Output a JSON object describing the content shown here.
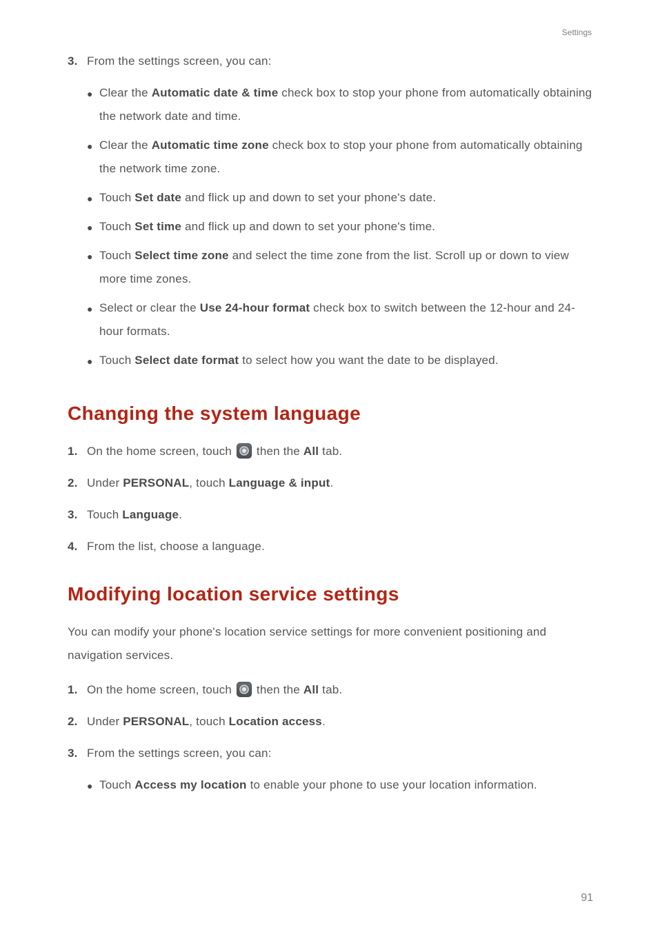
{
  "header": {
    "section_label": "Settings"
  },
  "step3": {
    "num": "3.",
    "lead": "From the settings screen, you can:",
    "bullets": [
      {
        "pre": "Clear the ",
        "bold": "Automatic date & time",
        "post": " check box to stop your phone from automatically obtaining the network date and time."
      },
      {
        "pre": "Clear the ",
        "bold": "Automatic time zone",
        "post": " check box to stop your phone from automatically obtaining the network time zone."
      },
      {
        "pre": "Touch ",
        "bold": "Set date",
        "post": " and flick up and down to set your phone's date."
      },
      {
        "pre": "Touch ",
        "bold": "Set time",
        "post": " and flick up and down to set your phone's time."
      },
      {
        "pre": "Touch ",
        "bold": "Select time zone",
        "post": " and select the time zone from the list. Scroll up or down to view more time zones."
      },
      {
        "pre": "Select or clear the ",
        "bold": "Use 24-hour format",
        "post": " check box to switch between the 12-hour and 24-hour formats."
      },
      {
        "pre": "Touch ",
        "bold": "Select date format",
        "post": " to select how you want the date to be displayed."
      }
    ]
  },
  "section_lang": {
    "heading": "Changing the system language",
    "steps": {
      "s1": {
        "num": "1.",
        "pre": "On the home screen, touch ",
        "mid": " then the ",
        "bold": "All",
        "post": " tab."
      },
      "s2": {
        "num": "2.",
        "pre": "Under ",
        "bold1": "PERSONAL",
        "mid": ", touch ",
        "bold2": "Language & input",
        "post": "."
      },
      "s3": {
        "num": "3.",
        "pre": "Touch ",
        "bold": "Language",
        "post": "."
      },
      "s4": {
        "num": "4.",
        "text": "From the list, choose a language."
      }
    }
  },
  "section_loc": {
    "heading": "Modifying location service settings",
    "intro": "You can modify your phone's location service settings for more convenient positioning and navigation services.",
    "steps": {
      "s1": {
        "num": "1.",
        "pre": "On the home screen, touch ",
        "mid": " then the ",
        "bold": "All",
        "post": " tab."
      },
      "s2": {
        "num": "2.",
        "pre": "Under ",
        "bold1": "PERSONAL",
        "mid": ", touch ",
        "bold2": "Location access",
        "post": "."
      },
      "s3": {
        "num": "3.",
        "lead": "From the settings screen, you can:",
        "bullet": {
          "pre": "Touch ",
          "bold": "Access my location",
          "post": " to enable your phone to use your location information."
        }
      }
    }
  },
  "page_number": "91"
}
